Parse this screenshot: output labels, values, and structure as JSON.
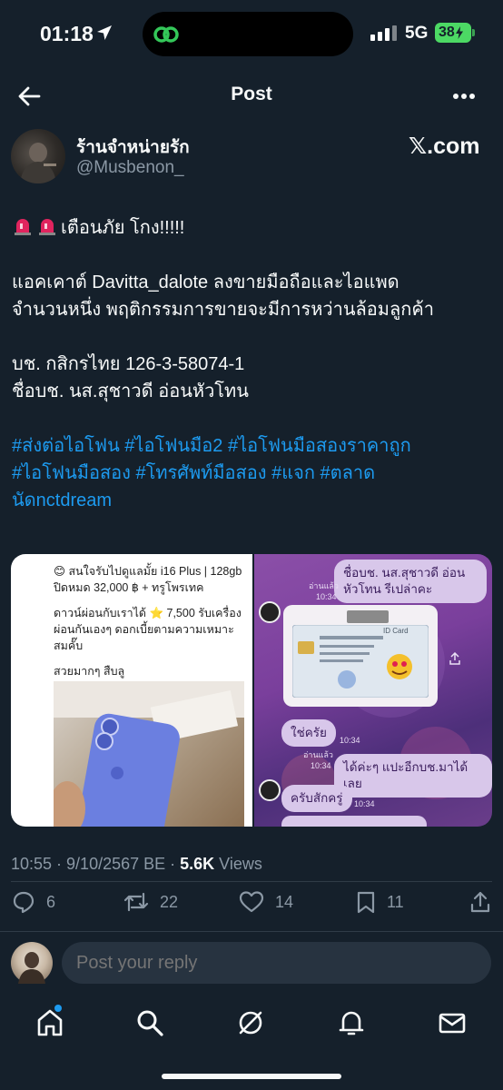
{
  "status_bar": {
    "time": "01:18",
    "network": "5G",
    "battery": "38"
  },
  "header": {
    "title": "Post"
  },
  "author": {
    "display_name": "ร้านจำหน่ายรัก",
    "handle": "@Musbenon_",
    "source": "𝕏.com"
  },
  "tweet": {
    "line1": "เตือนภัย  โกง!!!!!",
    "para2": [
      "แอคเคาต์ Davitta_dalote ลงขายมือถือและไอแพด",
      "จำนวนหนึ่ง พฤติกรรมการขายจะมีการหว่านล้อมลูกค้า"
    ],
    "para3": [
      "บช. กสิกรไทย 126-3-58074-1",
      "ชื่อบช. นส.สุชาวดี อ่อนหัวโทน"
    ],
    "hashtags": [
      "#ส่งต่อไอโฟน  #ไอโฟนมือ2 #ไอโฟนมือสองราคาถูก",
      "#ไอโฟนมือสอง #โทรศัพท์มือสอง #แจก #ตลาด",
      "นัดnctdream"
    ]
  },
  "media_left": {
    "line1": "😊 สนใจรับไปดูแลมั้ย i16 Plus | 128gb ปิดหมด 32,000 ฿ + ทรูโพรเทค",
    "line2": "ดาวน์ผ่อนกับเราได้ ⭐ 7,500 รับเครื่อง ผ่อนกันเองๆ ดอกเบี้ยตามความเหมาะสมคั๊บ",
    "line3": "สวยมากๆ สืบลู"
  },
  "media_right": {
    "bubble1": "ชื่อบช. นส.สุชาวดี อ่อนหัวโทน รีเปล่าคะ",
    "read1": "อ่านแล้ว",
    "time1": "10:34",
    "card_label": "ID Card",
    "bubble2": "ใช่ครัย",
    "time2": "10:34",
    "read2": "อ่านแล้ว",
    "time3": "10:34",
    "bubble3": "ได้ค่ะๆ แปะอีกบช.มาได้เลย",
    "bubble4": "ครับสักครู่",
    "time4": "10:34"
  },
  "meta": {
    "timestamp": "10:55 · 9/10/2567 BE · ",
    "views_count": "5.6K",
    "views_label": " Views"
  },
  "actions": {
    "replies": "6",
    "reposts": "22",
    "likes": "14",
    "bookmarks": "11"
  },
  "reply": {
    "placeholder": "Post your reply"
  },
  "colors": {
    "background": "#15202b",
    "accent": "#1d9bf0",
    "muted": "#8b98a5"
  }
}
